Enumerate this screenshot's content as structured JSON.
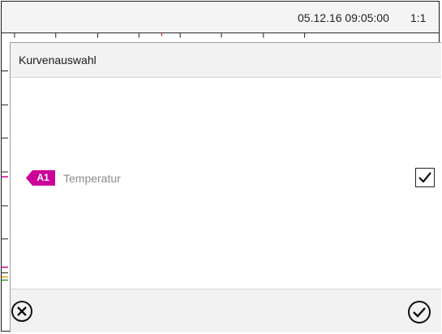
{
  "statusbar": {
    "datetime": "05.12.16 09:05:00",
    "zoom": "1:1"
  },
  "dialog": {
    "title": "Kurvenauswahl",
    "items": [
      {
        "tag": "A1",
        "tag_color": "#cc0099",
        "label": "Temperatur",
        "checked": true
      }
    ],
    "footer": {
      "cancel_icon": "cancel-circle-x-icon",
      "confirm_icon": "confirm-circle-check-icon"
    }
  }
}
